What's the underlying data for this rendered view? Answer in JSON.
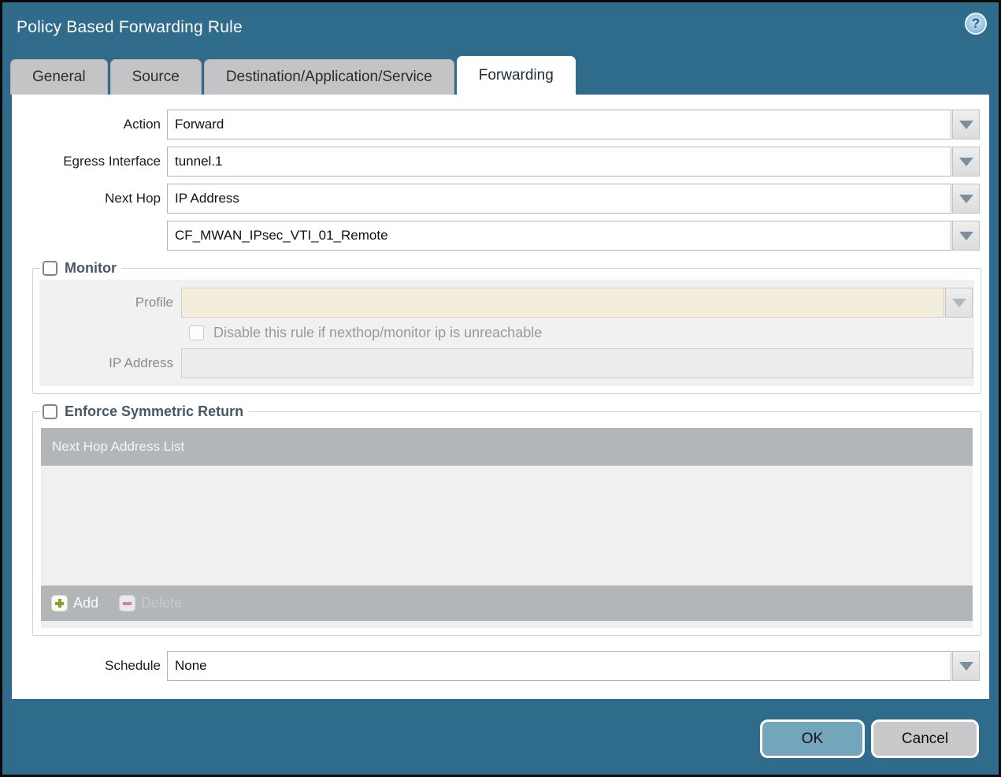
{
  "window": {
    "title": "Policy Based Forwarding Rule",
    "help_glyph": "?"
  },
  "tabs": [
    {
      "label": "General",
      "active": false
    },
    {
      "label": "Source",
      "active": false
    },
    {
      "label": "Destination/Application/Service",
      "active": false
    },
    {
      "label": "Forwarding",
      "active": true
    }
  ],
  "form": {
    "action_label": "Action",
    "action_value": "Forward",
    "egress_label": "Egress Interface",
    "egress_value": "tunnel.1",
    "next_hop_label": "Next Hop",
    "next_hop_value": "IP Address",
    "next_hop_address_value": "CF_MWAN_IPsec_VTI_01_Remote",
    "schedule_label": "Schedule",
    "schedule_value": "None"
  },
  "monitor": {
    "legend": "Monitor",
    "checked": false,
    "profile_label": "Profile",
    "profile_value": "",
    "disable_label": "Disable this rule if nexthop/monitor ip is unreachable",
    "disable_checked": false,
    "ip_label": "IP Address",
    "ip_value": ""
  },
  "symmetric": {
    "legend": "Enforce Symmetric Return",
    "checked": false,
    "table_header": "Next Hop Address List",
    "rows": [],
    "add_label": "Add",
    "delete_label": "Delete"
  },
  "footer": {
    "ok_label": "OK",
    "cancel_label": "Cancel"
  },
  "colors": {
    "titlebar": "#2f6b8b",
    "tab_inactive": "#c4c4c6",
    "tab_active": "#ffffff",
    "table_chrome": "#b2b6b9",
    "panel_disabled": "#f1f1f2",
    "profile_disabled_bg": "#f3eddc",
    "ok_button": "#74a6bb",
    "cancel_button": "#c9c9cb",
    "add_plus": "#8a9b2f",
    "delete_minus": "#d4848f",
    "legend_text": "#4a5763"
  }
}
